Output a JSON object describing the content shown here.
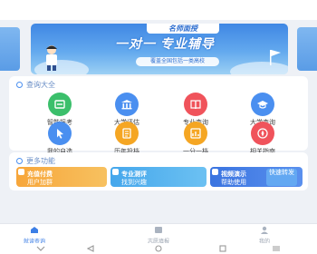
{
  "banner": {
    "sub_title": "名师面授",
    "main_title": "一对一 专业辅导",
    "tagline": "覆盖全国包括一类高校"
  },
  "sections": {
    "query_title": "查询大全",
    "more_title": "更多功能"
  },
  "query_items": [
    {
      "label": "智能报考",
      "icon": "smart-apply-icon",
      "color": "#3bbf6b"
    },
    {
      "label": "大学评估",
      "icon": "university-icon",
      "color": "#4a8ff0"
    },
    {
      "label": "专业查询",
      "icon": "book-icon",
      "color": "#f0535b"
    },
    {
      "label": "大学查询",
      "icon": "graduation-cap-icon",
      "color": "#4a8ff0"
    },
    {
      "label": "我的自选",
      "icon": "cursor-icon",
      "color": "#4a8ff0"
    },
    {
      "label": "历年投档",
      "icon": "document-icon",
      "color": "#f5a623"
    },
    {
      "label": "一分一档",
      "icon": "score-icon",
      "color": "#f5a623"
    },
    {
      "label": "相关指南",
      "icon": "guide-icon",
      "color": "#f0535b"
    }
  ],
  "more_features": [
    {
      "line1": "充值付费",
      "line2": "用户加群"
    },
    {
      "line1": "专业测评",
      "line2": "找到兴趣"
    },
    {
      "line1": "视频演示",
      "line2": "帮助使用",
      "chip": "快速转发"
    }
  ],
  "bottom_nav": [
    {
      "label": "就读查询",
      "active": true
    },
    {
      "label": "志愿填报",
      "active": false
    },
    {
      "label": "我的",
      "active": false
    }
  ]
}
